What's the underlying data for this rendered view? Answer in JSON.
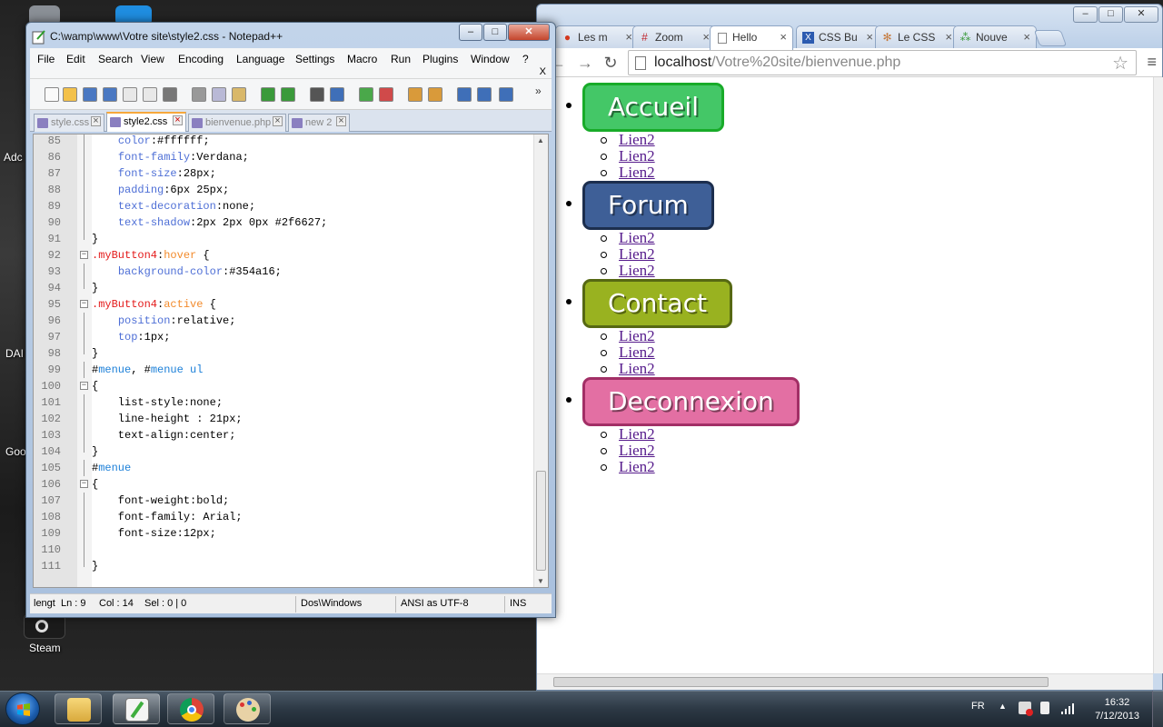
{
  "desktop": {
    "icons": [
      {
        "label": "Adc"
      },
      {
        "label": "DAI"
      },
      {
        "label": "Goo"
      },
      {
        "label": "Steam"
      }
    ]
  },
  "npp": {
    "title": "C:\\wamp\\www\\Votre site\\style2.css - Notepad++",
    "menu": [
      "File",
      "Edit",
      "Search",
      "View",
      "Encoding",
      "Language",
      "Settings",
      "Macro",
      "Run",
      "Plugins",
      "Window",
      "?"
    ],
    "close_x": "X",
    "tabs": [
      {
        "label": "style.css"
      },
      {
        "label": "style2.css"
      },
      {
        "label": "bienvenue.php"
      },
      {
        "label": "new  2"
      }
    ],
    "status": {
      "lengt": "lengt",
      "ln": "Ln : 9",
      "col": "Col : 14",
      "sel": "Sel : 0 | 0",
      "eol": "Dos\\Windows",
      "encoding": "ANSI as UTF-8",
      "mode": "INS"
    }
  },
  "browser": {
    "tabs": [
      {
        "label": "Les m",
        "icon": "C"
      },
      {
        "label": "Zoom",
        "icon": "#"
      },
      {
        "label": "Hello",
        "icon": "page"
      },
      {
        "label": "CSS Bu",
        "icon": "X"
      },
      {
        "label": "Le CSS",
        "icon": "gear"
      },
      {
        "label": "Nouve",
        "icon": "dots"
      }
    ],
    "url_host": "localhost",
    "url_path": "/Votre%20site/bienvenue.php",
    "menu": [
      {
        "label": "Accueil",
        "bg": "#44c767",
        "border": "#18ab29",
        "links": [
          "Lien2",
          "Lien2",
          "Lien2"
        ]
      },
      {
        "label": "Forum",
        "bg": "#3e5f97",
        "border": "#1c2e4e",
        "links": [
          "Lien2",
          "Lien2",
          "Lien2"
        ]
      },
      {
        "label": "Contact",
        "bg": "#99b220",
        "border": "#566813",
        "links": [
          "Lien2",
          "Lien2",
          "Lien2"
        ]
      },
      {
        "label": "Deconnexion",
        "bg": "#e36fa3",
        "border": "#a22f66",
        "links": [
          "Lien2",
          "Lien2",
          "Lien2"
        ]
      }
    ]
  },
  "taskbar": {
    "lang": "FR",
    "time": "16:32",
    "date": "7/12/2013",
    "apps": [
      "explorer",
      "notepad++",
      "chrome",
      "paint"
    ]
  },
  "code_lines": [
    {
      "n": "85",
      "fold": "",
      "html": "    <span class='prop'>color</span>:#ffffff;"
    },
    {
      "n": "86",
      "fold": "",
      "html": "    <span class='prop'>font-family</span>:Verdana;"
    },
    {
      "n": "87",
      "fold": "",
      "html": "    <span class='prop'>font-size</span>:28px;"
    },
    {
      "n": "88",
      "fold": "",
      "html": "    <span class='prop'>padding</span>:6px 25px;"
    },
    {
      "n": "89",
      "fold": "",
      "html": "    <span class='prop'>text-decoration</span>:none;"
    },
    {
      "n": "90",
      "fold": "",
      "html": "    <span class='prop'>text-shadow</span>:2px 2px 0px #2f6627;"
    },
    {
      "n": "91",
      "fold": "end",
      "html": "}"
    },
    {
      "n": "92",
      "fold": "box",
      "html": "<span class='sel'>.myButton4</span>:<span class='ps'>hover</span> {"
    },
    {
      "n": "93",
      "fold": "",
      "html": "    <span class='prop'>background-color</span>:#354a16;"
    },
    {
      "n": "94",
      "fold": "end",
      "html": "}"
    },
    {
      "n": "95",
      "fold": "box",
      "html": "<span class='sel'>.myButton4</span>:<span class='ps'>active</span> {"
    },
    {
      "n": "96",
      "fold": "",
      "html": "    <span class='prop'>position</span>:relative;"
    },
    {
      "n": "97",
      "fold": "",
      "html": "    <span class='prop'>top</span>:1px;"
    },
    {
      "n": "98",
      "fold": "end",
      "html": "}"
    },
    {
      "n": "99",
      "fold": "",
      "html": "#<span class='idn'>menue</span>, #<span class='idn'>menue</span> <span class='idn'>ul</span>"
    },
    {
      "n": "100",
      "fold": "box",
      "html": "{"
    },
    {
      "n": "101",
      "fold": "",
      "html": "    list-style:none;"
    },
    {
      "n": "102",
      "fold": "",
      "html": "    line-height : 21px;"
    },
    {
      "n": "103",
      "fold": "",
      "html": "    text-align:center;"
    },
    {
      "n": "104",
      "fold": "end",
      "html": "}"
    },
    {
      "n": "105",
      "fold": "",
      "html": "#<span class='idn'>menue</span>"
    },
    {
      "n": "106",
      "fold": "box",
      "html": "{"
    },
    {
      "n": "107",
      "fold": "",
      "html": "    font-weight:bold;"
    },
    {
      "n": "108",
      "fold": "",
      "html": "    font-family: Arial;"
    },
    {
      "n": "109",
      "fold": "",
      "html": "    font-size:12px;"
    },
    {
      "n": "110",
      "fold": "",
      "html": ""
    },
    {
      "n": "111",
      "fold": "end",
      "html": "}"
    }
  ]
}
